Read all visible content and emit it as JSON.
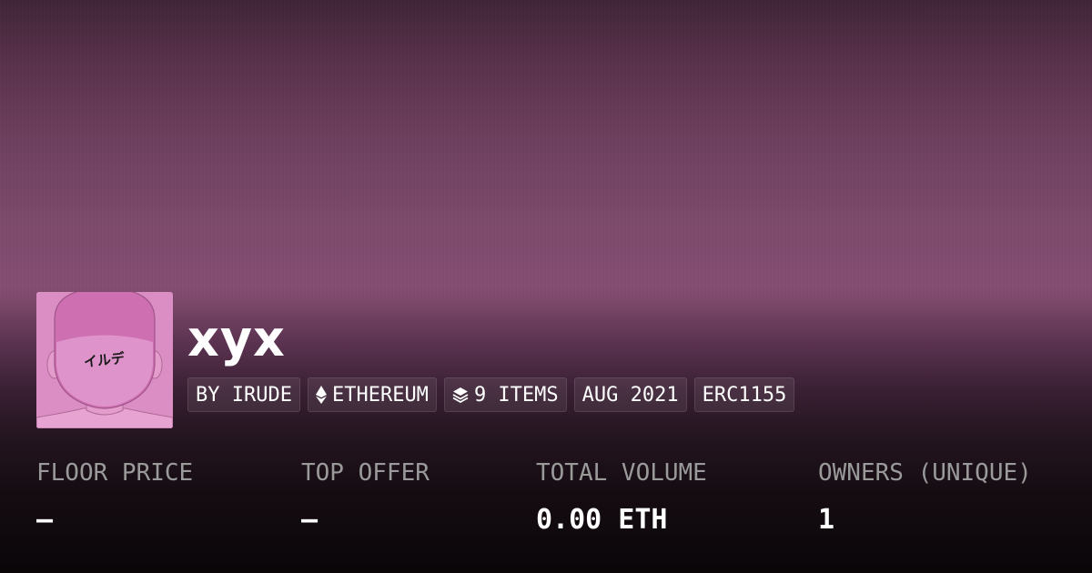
{
  "collection": {
    "title": "xyx",
    "avatar_text": "イルデ",
    "avatar_bg": "#db8ec4"
  },
  "tags": [
    {
      "label": "BY IRUDE",
      "icon": ""
    },
    {
      "label": "ETHEREUM",
      "icon": "ethereum-icon"
    },
    {
      "label": "9 ITEMS",
      "icon": "layers-icon"
    },
    {
      "label": "AUG 2021",
      "icon": ""
    },
    {
      "label": "ERC1155",
      "icon": ""
    }
  ],
  "stats": [
    {
      "label": "FLOOR PRICE",
      "value": "—"
    },
    {
      "label": "TOP OFFER",
      "value": "—"
    },
    {
      "label": "TOTAL VOLUME",
      "value": "0.00 ETH"
    },
    {
      "label": "OWNERS (UNIQUE)",
      "value": "1"
    }
  ],
  "colors": {
    "banner": "#844d71",
    "label": "#9a9a9a",
    "text": "#ffffff"
  }
}
